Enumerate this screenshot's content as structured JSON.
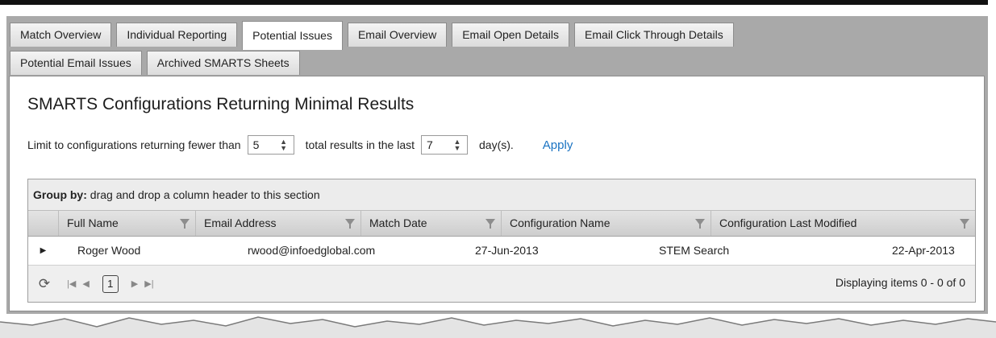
{
  "tabs_row1": [
    "Match Overview",
    "Individual Reporting",
    "Potential Issues",
    "Email Overview",
    "Email Open Details",
    "Email Click Through Details"
  ],
  "tabs_row2": [
    "Potential Email Issues",
    "Archived SMARTS Sheets"
  ],
  "active_tab": "Potential Issues",
  "panel": {
    "title": "SMARTS Configurations Returning Minimal Results",
    "filter": {
      "prefix": "Limit to configurations returning fewer than",
      "count_value": "5",
      "middle": "total results in the last",
      "days_value": "7",
      "suffix": "day(s).",
      "apply_label": "Apply"
    }
  },
  "grid": {
    "group_label": "Group by:",
    "group_hint": "drag and drop a column header to this section",
    "columns": [
      "Full Name",
      "Email Address",
      "Match Date",
      "Configuration Name",
      "Configuration Last Modified"
    ],
    "rows": [
      [
        "Roger Wood",
        "rwood@infoedglobal.com",
        "27-Jun-2013",
        "STEM Search",
        "22-Apr-2013"
      ]
    ],
    "pager": {
      "current_page": "1",
      "info": "Displaying items 0 - 0 of 0"
    }
  },
  "icons": {
    "refresh": "refresh-icon",
    "first": "first-page-icon",
    "prev": "prev-page-icon",
    "next": "next-page-icon",
    "last": "last-page-icon",
    "filter": "filter-icon",
    "expand": "expand-row-icon"
  },
  "colors": {
    "accent": "#1a73c2",
    "frame": "#a9a9a9"
  }
}
